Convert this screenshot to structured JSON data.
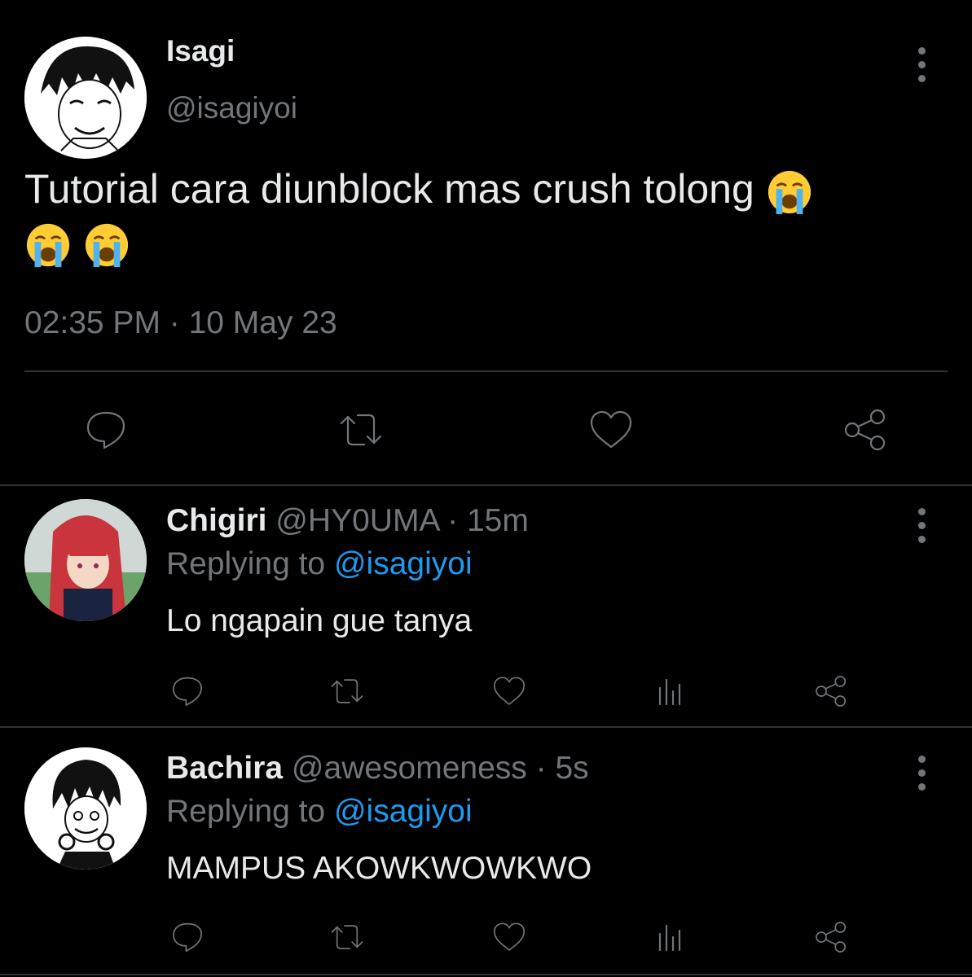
{
  "main_tweet": {
    "name": "Isagi",
    "handle": "@isagiyoi",
    "text": "Tutorial cara diunblock mas crush tolong",
    "emoji_names": [
      "loudly-crying-face-icon",
      "loudly-crying-face-icon",
      "loudly-crying-face-icon"
    ],
    "timestamp": "02:35 PM · 10 May 23",
    "actions": [
      "reply-icon",
      "retweet-icon",
      "like-icon",
      "share-icon"
    ]
  },
  "replies": [
    {
      "name": "Chigiri",
      "handle": "@HY0UMA",
      "time": "· 15m",
      "replying_prefix": "Replying to",
      "replying_to": "@isagiyoi",
      "text": "Lo ngapain gue tanya"
    },
    {
      "name": "Bachira",
      "handle": "@awesomeness",
      "time": "· 5s",
      "replying_prefix": "Replying to",
      "replying_to": "@isagiyoi",
      "text": "MAMPUS AKOWKWOWKWO"
    }
  ],
  "colors": {
    "background": "#000000",
    "text": "#e7e9ea",
    "muted": "#71767b",
    "link": "#1d9bf0",
    "divider": "#2f3336"
  }
}
